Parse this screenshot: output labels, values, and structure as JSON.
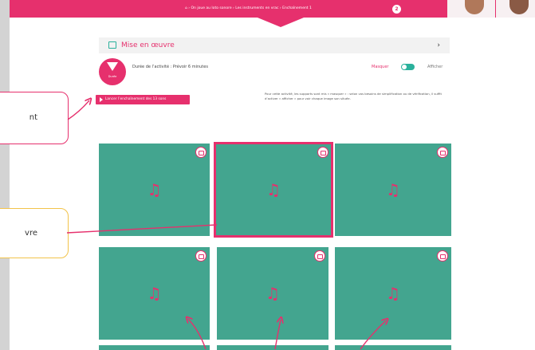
{
  "header": {
    "breadcrumb": "⌂ › On joue au loto sonore › Les instruments en vrac › Enchaînement 1",
    "badge": "2"
  },
  "section": {
    "title": "Mise en œuvre",
    "chevron": "›"
  },
  "timer": {
    "label": "Durée"
  },
  "activity": {
    "duration": "Durée de l’activité : Prévoir 6 minutes"
  },
  "toggle": {
    "left_label": "Masquer",
    "right_label": "Afficher",
    "state": "on"
  },
  "launch_button": {
    "label": "Lancer l’enchaînement des 13 sons"
  },
  "help_text": "Pour cette activité, les supports sont mis « masquer » : selon vos besoins de simplification ou de vérification, il suffit d’activer « afficher » pour voir chaque image son située.",
  "grid": {
    "cards": [
      {
        "icon": "music-note-icon",
        "selected": false
      },
      {
        "icon": "music-note-icon",
        "selected": true
      },
      {
        "icon": "music-note-icon",
        "selected": false
      },
      {
        "icon": "music-note-icon",
        "selected": false
      },
      {
        "icon": "music-note-icon",
        "selected": false
      },
      {
        "icon": "music-note-icon",
        "selected": false
      }
    ],
    "card_color": "#43a58f",
    "note_glyph": "♫"
  },
  "callouts": {
    "launch_fragment": "nt",
    "grid_fragment": "vre"
  },
  "colors": {
    "accent": "#e6306d",
    "teal": "#2bb19c",
    "callout_yellow": "#f2c34a"
  }
}
